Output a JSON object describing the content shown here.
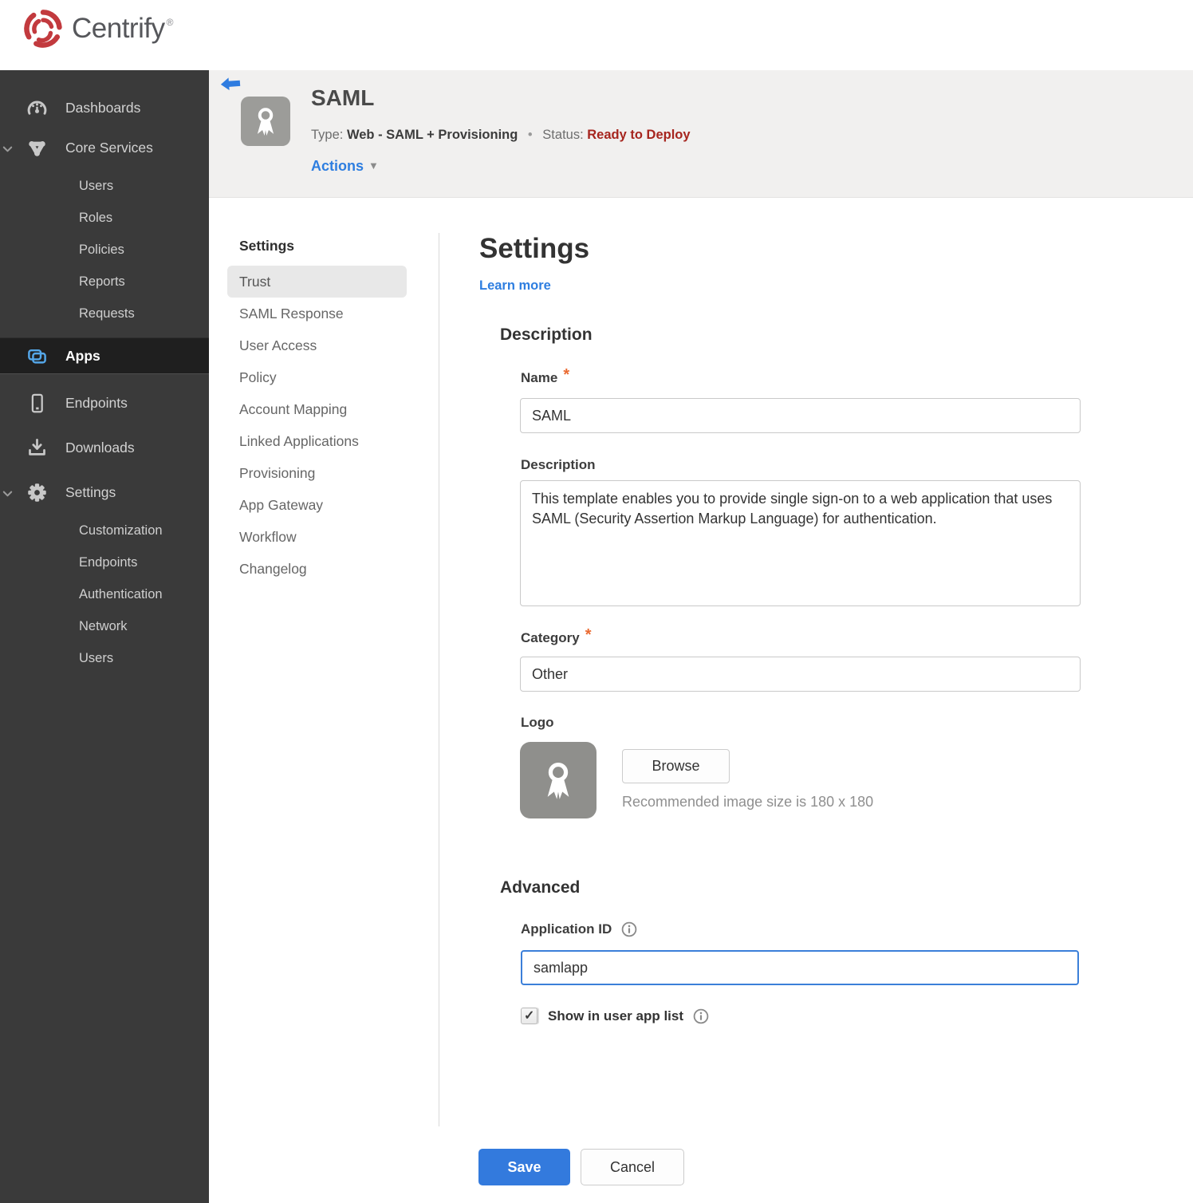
{
  "colors": {
    "accent_blue": "#2e7ee0",
    "save_blue": "#337add",
    "status_red": "#a6251e",
    "brand_red": "#c23a3e",
    "apps_icon_blue": "#54a7e9",
    "sidebar_bg": "#3a3a3a",
    "header_band_bg": "#f1f0ef"
  },
  "brand": {
    "logo_text": "Centrify",
    "trademark": "®"
  },
  "sidebar": {
    "dashboards": "Dashboards",
    "core_services": "Core Services",
    "core_children": [
      "Users",
      "Roles",
      "Policies",
      "Reports",
      "Requests"
    ],
    "apps": "Apps",
    "endpoints": "Endpoints",
    "downloads": "Downloads",
    "settings": "Settings",
    "settings_children": [
      "Customization",
      "Endpoints",
      "Authentication",
      "Network",
      "Users"
    ]
  },
  "header": {
    "app_title": "SAML",
    "type_label": "Type:",
    "type_value": "Web - SAML + Provisioning",
    "separator": "•",
    "status_label": "Status:",
    "status_value": "Ready to Deploy",
    "actions_label": "Actions",
    "actions_caret": "▼"
  },
  "subnav": {
    "section_title": "Settings",
    "selected": "Trust",
    "items": [
      "Trust",
      "SAML Response",
      "User Access",
      "Policy",
      "Account Mapping",
      "Linked Applications",
      "Provisioning",
      "App Gateway",
      "Workflow",
      "Changelog"
    ]
  },
  "main": {
    "title": "Settings",
    "learn_more": "Learn more",
    "description_section": {
      "title": "Description",
      "name_label": "Name",
      "required_marker": "*",
      "name_value": "SAML",
      "description_label": "Description",
      "description_value": "This template enables you to provide single sign-on to a web application that uses SAML (Security Assertion Markup Language) for authentication.",
      "category_label": "Category",
      "category_value": "Other",
      "logo_label": "Logo",
      "browse_button": "Browse",
      "logo_hint": "Recommended image size is 180 x 180"
    },
    "advanced_section": {
      "title": "Advanced",
      "application_id_label": "Application ID",
      "application_id_value": "samlapp",
      "show_in_app_list_label": "Show in user app list",
      "checkbox_checked": true
    },
    "save_button": "Save",
    "cancel_button": "Cancel"
  }
}
